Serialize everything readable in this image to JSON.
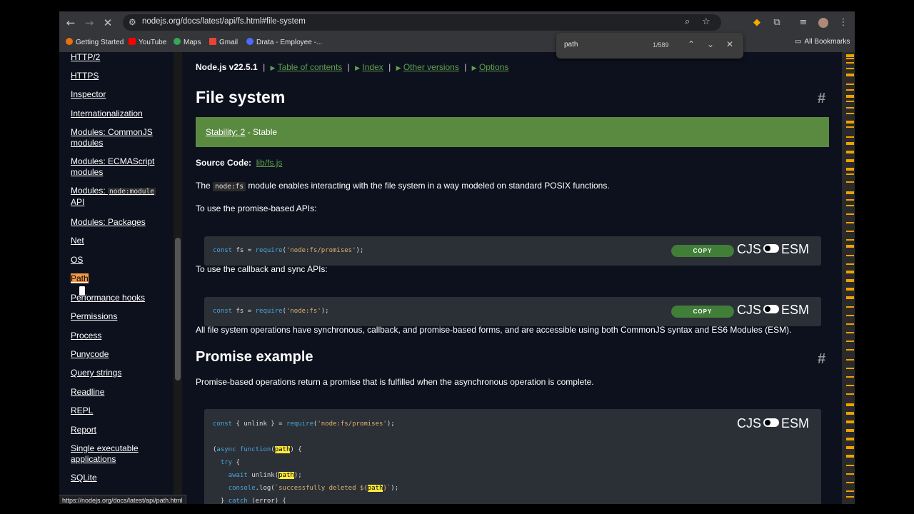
{
  "browser": {
    "url": "nodejs.org/docs/latest/api/fs.html#file-system",
    "status_url": "https://nodejs.org/docs/latest/api/path.html",
    "bookmarks": [
      {
        "label": "Getting Started",
        "color": "#e8710a"
      },
      {
        "label": "YouTube",
        "color": "#ff0000"
      },
      {
        "label": "Maps",
        "color": "#34a853"
      },
      {
        "label": "Gmail",
        "color": "#ea4335"
      },
      {
        "label": "Drata - Employee -...",
        "color": "#4b6bfb"
      }
    ],
    "all_bookmarks": "All Bookmarks",
    "find": {
      "query": "path",
      "count": "1/589"
    }
  },
  "sidebar": {
    "items": [
      "HTTP/2",
      "HTTPS",
      "Inspector",
      "Internationalization",
      "Modules: CommonJS modules",
      "Modules: ECMAScript modules",
      "Modules: ",
      "node:module",
      "API",
      "Modules: Packages",
      "Net",
      "OS",
      "Path",
      "Performance hooks",
      "Permissions",
      "Process",
      "Punycode",
      "Query strings",
      "Readline",
      "REPL",
      "Report",
      "Single executable applications",
      "SQLite"
    ]
  },
  "topnav": {
    "version": "Node.js v22.5.1",
    "links": [
      "Table of contents",
      "Index",
      "Other versions",
      "Options"
    ]
  },
  "content": {
    "title": "File system",
    "stability_link": "Stability: 2",
    "stability_text": " - Stable",
    "source_label": "Source Code:",
    "source_link": "lib/fs.js",
    "intro_pre": "The ",
    "intro_code": "node:fs",
    "intro_post": " module enables interacting with the file system in a way modeled on standard POSIX functions.",
    "promise_api": "To use the promise-based APIs:",
    "callback_api": "To use the callback and sync APIs:",
    "all_ops": "All file system operations have synchronous, callback, and promise-based forms, and are accessible using both CommonJS syntax and ES6 Modules (ESM).",
    "promise_title": "Promise example",
    "promise_desc": "Promise-based operations return a promise that is fulfilled when the asynchronous operation is complete.",
    "copy_label": "COPY",
    "cjs": "CJS",
    "esm": "ESM",
    "hash": "#"
  }
}
